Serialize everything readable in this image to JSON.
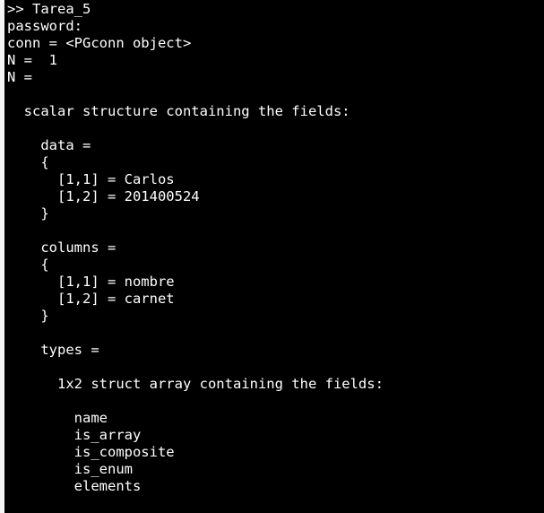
{
  "terminal": {
    "lines": [
      ">> Tarea_5",
      "password:",
      "conn = <PGconn object>",
      "N =  1",
      "N =",
      "",
      "  scalar structure containing the fields:",
      "",
      "    data =",
      "    {",
      "      [1,1] = Carlos",
      "      [1,2] = 201400524",
      "    }",
      "",
      "    columns =",
      "    {",
      "      [1,1] = nombre",
      "      [1,2] = carnet",
      "    }",
      "",
      "    types =",
      "",
      "      1x2 struct array containing the fields:",
      "",
      "        name",
      "        is_array",
      "        is_composite",
      "        is_enum",
      "        elements"
    ]
  },
  "colors": {
    "background": "#000000",
    "text": "#ffffff",
    "left_border": "#f5f5f5"
  }
}
